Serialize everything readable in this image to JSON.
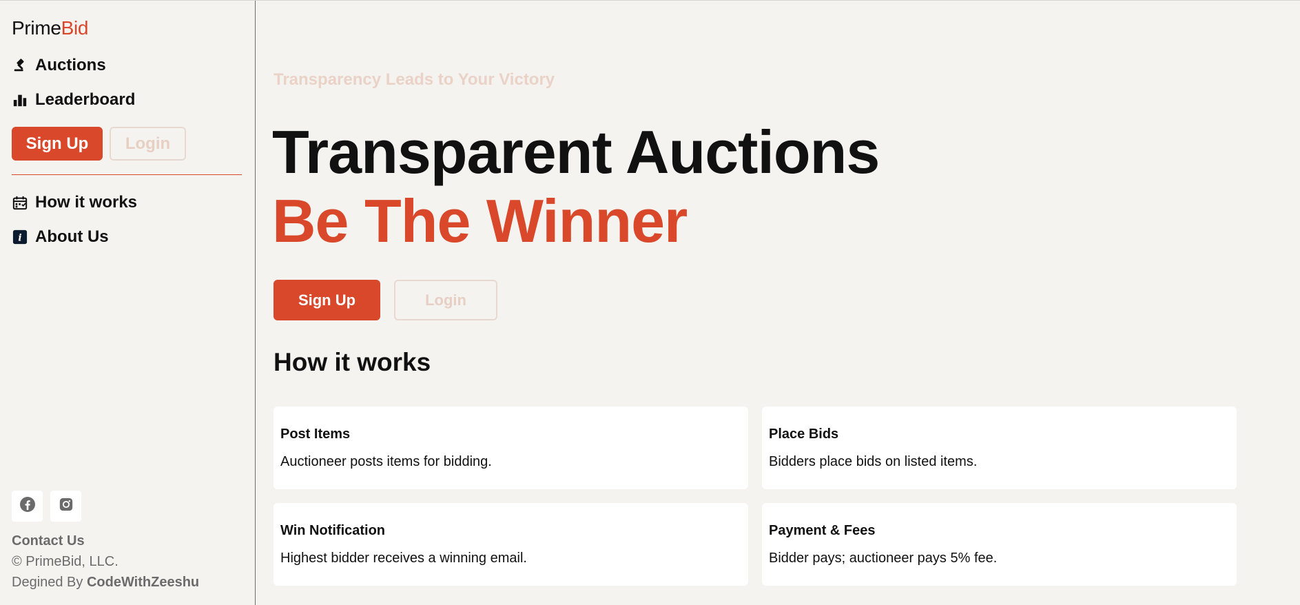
{
  "brand": {
    "prefix": "Prime",
    "accent": "Bid"
  },
  "sidebar": {
    "nav_primary": [
      {
        "label": "Auctions",
        "icon": "gavel-icon"
      },
      {
        "label": "Leaderboard",
        "icon": "bar-chart-icon"
      }
    ],
    "signup_label": "Sign Up",
    "login_label": "Login",
    "nav_secondary": [
      {
        "label": "How it works",
        "icon": "calendar-icon"
      },
      {
        "label": "About Us",
        "icon": "info-icon"
      }
    ],
    "socials": [
      "facebook-icon",
      "instagram-icon"
    ],
    "contact_label": "Contact Us",
    "copyright": "© PrimeBid, LLC.",
    "designed_prefix": "Degined By ",
    "designed_by": "CodeWithZeeshu"
  },
  "hero": {
    "tagline": "Transparency Leads to Your Victory",
    "title_line1": "Transparent Auctions",
    "title_line2": "Be The Winner",
    "signup_label": "Sign Up",
    "login_label": "Login"
  },
  "how_it_works": {
    "title": "How it works",
    "steps": [
      {
        "title": "Post Items",
        "desc": "Auctioneer posts items for bidding."
      },
      {
        "title": "Place Bids",
        "desc": "Bidders place bids on listed items."
      },
      {
        "title": "Win Notification",
        "desc": "Highest bidder receives a winning email."
      },
      {
        "title": "Payment & Fees",
        "desc": "Bidder pays; auctioneer pays 5% fee."
      }
    ]
  },
  "colors": {
    "accent": "#d9482b",
    "background": "#f4f3f0",
    "muted": "#6b6b6b"
  }
}
